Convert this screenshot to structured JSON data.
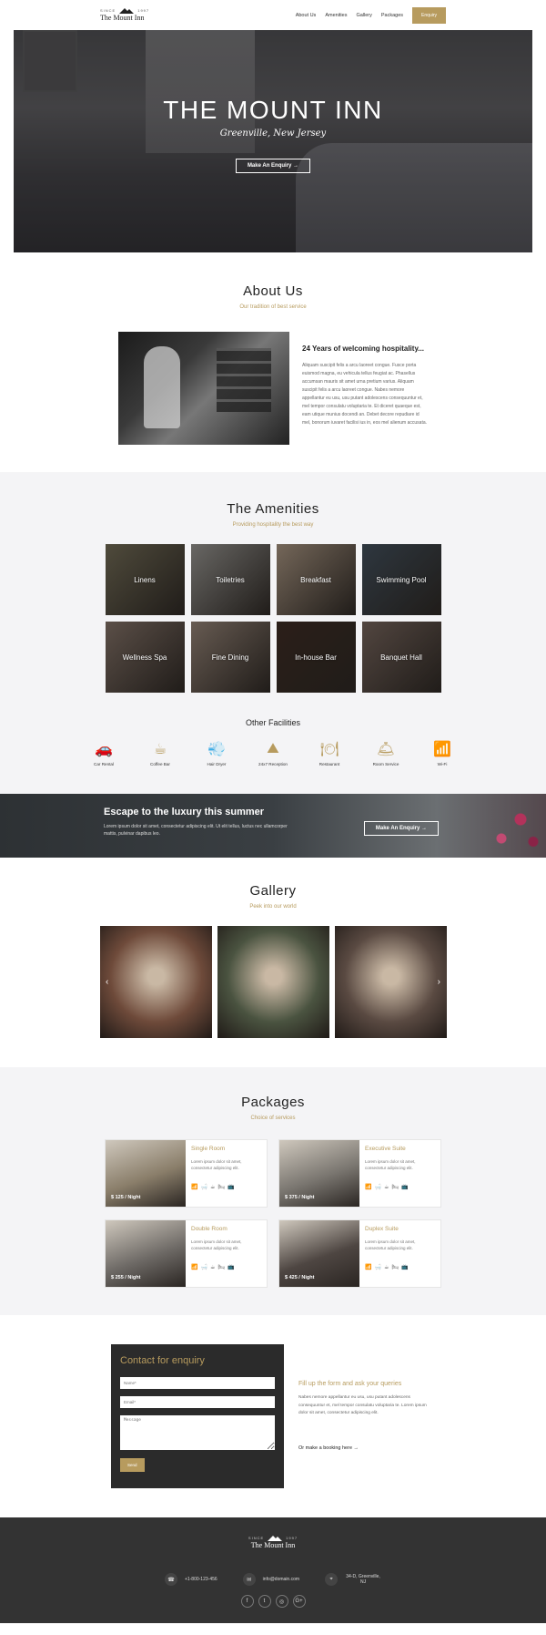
{
  "header": {
    "logo": {
      "since": "SINCE",
      "year": "1997",
      "name": "The Mount Inn"
    },
    "nav": [
      "About Us",
      "Amenities",
      "Gallery",
      "Packages"
    ],
    "enquiry_button": "Enquiry"
  },
  "hero": {
    "title": "THE MOUNT INN",
    "subtitle": "Greenville, New Jersey",
    "button": "Make An Enquiry →"
  },
  "about": {
    "title": "About Us",
    "subtitle": "Our tradition of best service",
    "heading": "24 Years of welcoming hospitality...",
    "body": "Aliquam suscipit felis a arcu laoreet congue. Fusce porta euismod magna, eu vehicula tellus feugiat ac. Phasellus accumsan mauris sit amet urna pretium varius. Aliquam suscipit felis a arcu laoreet congue. Nabes nemore appellantur eu usu, usu putant adolescens consequuntur et, mel tempor consulatu voluptaria te. Et diceret quaeque est, eam utique munius docendi an. Debet decore repudiare id mel, bonorum iuvaret facilisi ius in, eos mel alienum accusata."
  },
  "amenities": {
    "title": "The Amenities",
    "subtitle": "Providing hospitality the best way",
    "cards": [
      {
        "label": "Linens",
        "color": "#6a6450"
      },
      {
        "label": "Toiletries",
        "color": "#8c8a86"
      },
      {
        "label": "Breakfast",
        "color": "#9c8a78"
      },
      {
        "label": "Swimming Pool",
        "color": "#3e4a55"
      },
      {
        "label": "Wellness Spa",
        "color": "#7a6a60"
      },
      {
        "label": "Fine Dining",
        "color": "#8a7a6e"
      },
      {
        "label": "In-house Bar",
        "color": "#3a2a22"
      },
      {
        "label": "Banquet Hall",
        "color": "#6e5e56"
      }
    ],
    "facilities_title": "Other Facilities",
    "facilities": [
      {
        "label": "Car Rental",
        "icon": "car-icon",
        "glyph": "🚗"
      },
      {
        "label": "Coffee Bar",
        "icon": "coffee-icon",
        "glyph": "☕"
      },
      {
        "label": "Hair Dryer",
        "icon": "hair-dryer-icon",
        "glyph": "💨"
      },
      {
        "label": "24x7 Reception",
        "icon": "reception-icon",
        "glyph": "⛰"
      },
      {
        "label": "Restaurant",
        "icon": "restaurant-icon",
        "glyph": "🍽"
      },
      {
        "label": "Room Service",
        "icon": "room-service-icon",
        "glyph": "🛎"
      },
      {
        "label": "Wi-Fi",
        "icon": "wifi-icon",
        "glyph": "📶"
      }
    ]
  },
  "escape": {
    "title": "Escape to the luxury this summer",
    "body_line1": "Lorem ipsum dolor sit amet, consectetur adipiscing elit. Ut elit tellus, luctus nec ullamcorper",
    "body_line2": "mattis, pulvinar dapibus leo.",
    "button": "Make An Enquiry →"
  },
  "gallery": {
    "title": "Gallery",
    "subtitle": "Peek into our world",
    "images": [
      {
        "color": "#6e4a3a",
        "icon": "kitchen-image"
      },
      {
        "color": "#4a5340",
        "icon": "window-view-image"
      },
      {
        "color": "#5a4a42",
        "icon": "spa-room-image"
      }
    ]
  },
  "packages": {
    "title": "Packages",
    "subtitle": "Choice of services",
    "items": [
      {
        "name": "Single Room",
        "price": "$ 125 / Night",
        "desc": "Lorem ipsum dolor sit amet, consectetur adipiscing elit.",
        "color": "#8a7e6a"
      },
      {
        "name": "Executive Suite",
        "price": "$ 375 / Night",
        "desc": "Lorem ipsum dolor sit amet, consectetur adipiscing elit.",
        "color": "#7a7670"
      },
      {
        "name": "Double Room",
        "price": "$ 255 / Night",
        "desc": "Lorem ipsum dolor sit amet, consectetur adipiscing elit.",
        "color": "#6e6a66"
      },
      {
        "name": "Duplex Suite",
        "price": "$ 425 / Night",
        "desc": "Lorem ipsum dolor sit amet, consectetur adipiscing elit.",
        "color": "#4e4642"
      }
    ]
  },
  "contact": {
    "title": "Contact for enquiry",
    "name_placeholder": "Name*",
    "email_placeholder": "Email*",
    "message_placeholder": "Message",
    "send": "Send",
    "side_heading": "Fill up the form and ask your queries",
    "side_body": "Nabes nemore appellantur eu usu, usu putant adolescens consequuntur et, mel tempor consulatu voluptaria te. Lorem ipsum dolor sit amet, consectetur adipiscing elit.",
    "booking": "Or make a booking here →"
  },
  "footer": {
    "phone": "+1-800-123-456",
    "email": "info@domain.com",
    "address": "34-D, Greenville, NJ"
  }
}
